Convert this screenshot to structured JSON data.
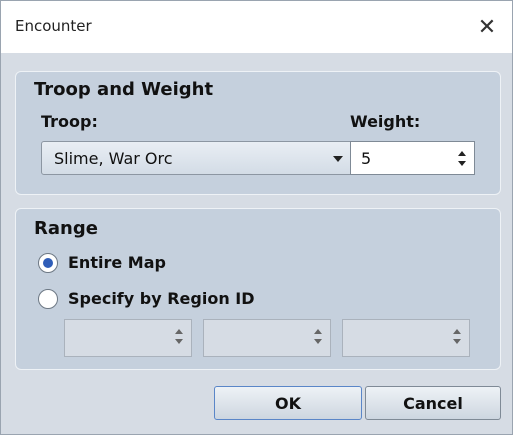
{
  "dialog": {
    "title": "Encounter",
    "close_glyph": "✕"
  },
  "troop_group": {
    "title": "Troop and Weight",
    "troop_label": "Troop:",
    "troop_value": "Slime, War Orc",
    "weight_label": "Weight:",
    "weight_value": "5"
  },
  "range_group": {
    "title": "Range",
    "options": [
      "Entire Map",
      "Specify by Region ID"
    ],
    "selected": "Entire Map",
    "region_ids": [
      "",
      "",
      ""
    ]
  },
  "buttons": {
    "ok": "OK",
    "cancel": "Cancel"
  },
  "colors": {
    "accent": "#2f5db8",
    "background": "#d6dce4",
    "group": "#c5d0dd"
  }
}
